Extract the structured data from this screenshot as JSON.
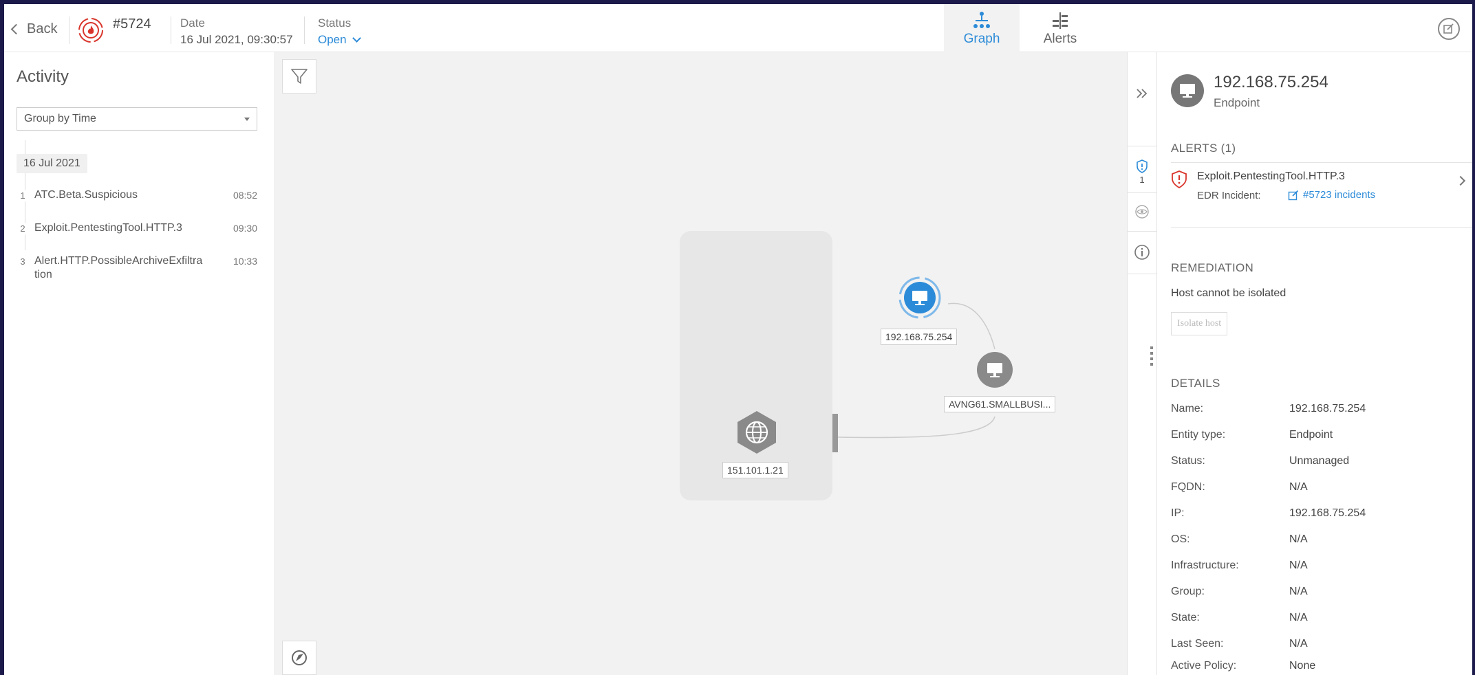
{
  "header": {
    "back_label": "Back",
    "incident_id": "#5724",
    "date_label": "Date",
    "date_value": "16 Jul 2021, 09:30:57",
    "status_label": "Status",
    "status_value": "Open",
    "tabs": [
      {
        "label": "Graph",
        "icon": "graph-icon",
        "active": true
      },
      {
        "label": "Alerts",
        "icon": "alerts-icon",
        "active": false
      }
    ]
  },
  "activity": {
    "title": "Activity",
    "group_by": "Group by Time",
    "date_chip": "16 Jul 2021",
    "items": [
      {
        "num": "1",
        "name": "ATC.Beta.Suspicious",
        "time": "08:52"
      },
      {
        "num": "2",
        "name": "Exploit.PentestingTool.HTTP.3",
        "time": "09:30"
      },
      {
        "num": "3",
        "name": "Alert.HTTP.PossibleArchiveExfiltra tion",
        "time": "10:33"
      }
    ]
  },
  "graph": {
    "nodes": [
      {
        "label": "192.168.75.254",
        "icon": "endpoint-icon",
        "selected": true
      },
      {
        "label": "AVNG61.SMALLBUSI...",
        "icon": "endpoint-icon",
        "selected": false
      },
      {
        "label": "151.101.1.21",
        "icon": "globe-icon",
        "selected": false
      }
    ]
  },
  "strip": {
    "alert_count": "1"
  },
  "entity": {
    "title": "192.168.75.254",
    "subtitle": "Endpoint",
    "alerts_heading": "ALERTS (1)",
    "alert_name": "Exploit.PentestingTool.HTTP.3",
    "edr_label": "EDR Incident:",
    "edr_link": "#5723 incidents",
    "remediation_heading": "REMEDIATION",
    "remediation_text": "Host cannot be isolated",
    "isolate_button": "Isolate host",
    "details_heading": "DETAILS",
    "details": [
      {
        "key": "Name:",
        "value": "192.168.75.254"
      },
      {
        "key": "Entity type:",
        "value": "Endpoint"
      },
      {
        "key": "Status:",
        "value": "Unmanaged"
      },
      {
        "key": "FQDN:",
        "value": "N/A"
      },
      {
        "key": "IP:",
        "value": "192.168.75.254"
      },
      {
        "key": "OS:",
        "value": "N/A"
      },
      {
        "key": "Infrastructure:",
        "value": "N/A"
      },
      {
        "key": "Group:",
        "value": "N/A"
      },
      {
        "key": "State:",
        "value": "N/A"
      },
      {
        "key": "Last Seen:",
        "value": "N/A"
      },
      {
        "key": "Active Policy:",
        "value": "None"
      }
    ]
  },
  "colors": {
    "accent": "#2c8bd8",
    "danger": "#d9342b",
    "node_gray": "#8a8a8a",
    "frame_bg": "#1c1a4a"
  }
}
